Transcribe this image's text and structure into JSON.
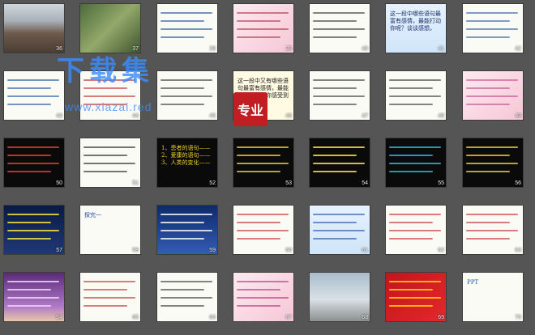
{
  "watermark": {
    "title": "下载集",
    "url": "www.xiazai.red",
    "seal": "专业"
  },
  "slides": [
    {
      "num": "36",
      "bg": "bg-mountain",
      "accent": "#6d5b4c"
    },
    {
      "num": "37",
      "bg": "bg-green",
      "accent": "#3f5530"
    },
    {
      "num": "38",
      "bg": "bg-white",
      "accent": "#1e4fa0"
    },
    {
      "num": "39",
      "bg": "bg-pink",
      "accent": "#b0324a"
    },
    {
      "num": "40",
      "bg": "bg-white",
      "accent": "#333333"
    },
    {
      "num": "41",
      "bg": "bg-lightblue",
      "accent": "#1a2b66",
      "text": "这一段中哪些语句最富有感情，最能打动你呢？谈谈感想。"
    },
    {
      "num": "42",
      "bg": "bg-white",
      "accent": "#2b5aa8"
    },
    {
      "num": "43",
      "bg": "bg-white",
      "accent": "#1e4fa0"
    },
    {
      "num": "44",
      "bg": "bg-white",
      "accent": "#c0282d"
    },
    {
      "num": "45",
      "bg": "bg-white",
      "accent": "#333333"
    },
    {
      "num": "46",
      "bg": "bg-yellow",
      "accent": "#1a1a1a",
      "text": "这一段中又有哪些语句最富有感情，最能打动你呢？你感受到了什么？"
    },
    {
      "num": "47",
      "bg": "bg-white",
      "accent": "#333333"
    },
    {
      "num": "48",
      "bg": "bg-white",
      "accent": "#333333"
    },
    {
      "num": "49",
      "bg": "bg-pink",
      "accent": "#c04a8a"
    },
    {
      "num": "50",
      "bg": "bg-black",
      "accent": "#e03a2a"
    },
    {
      "num": "51",
      "bg": "bg-white",
      "accent": "#1a1a1a"
    },
    {
      "num": "52",
      "bg": "bg-black",
      "accent": "#f0d020",
      "text": "1、患者的语句——  2、爱康的语句——  3、人类的变化——"
    },
    {
      "num": "53",
      "bg": "bg-black",
      "accent": "#e0c030"
    },
    {
      "num": "54",
      "bg": "bg-black",
      "accent": "#f0e040"
    },
    {
      "num": "55",
      "bg": "bg-black",
      "accent": "#2ab0d0"
    },
    {
      "num": "56",
      "bg": "bg-black",
      "accent": "#e0c030"
    },
    {
      "num": "57",
      "bg": "bg-navy",
      "accent": "#f0e040"
    },
    {
      "num": "58",
      "bg": "bg-white",
      "accent": "#1e4fa0",
      "text": "探究一"
    },
    {
      "num": "59",
      "bg": "bg-blue",
      "accent": "#f0f0f0"
    },
    {
      "num": "60",
      "bg": "bg-white",
      "accent": "#c0282d"
    },
    {
      "num": "61",
      "bg": "bg-lightblue",
      "accent": "#1e4fa0"
    },
    {
      "num": "62",
      "bg": "bg-white",
      "accent": "#c0282d"
    },
    {
      "num": "63",
      "bg": "bg-white",
      "accent": "#c0282d"
    },
    {
      "num": "64",
      "bg": "bg-purple",
      "accent": "#f0d0ff"
    },
    {
      "num": "65",
      "bg": "bg-white",
      "accent": "#c0282d"
    },
    {
      "num": "66",
      "bg": "bg-white",
      "accent": "#333333"
    },
    {
      "num": "67",
      "bg": "bg-pink",
      "accent": "#b03070"
    },
    {
      "num": "68",
      "bg": "bg-city",
      "accent": "#5a6a78"
    },
    {
      "num": "69",
      "bg": "bg-red",
      "accent": "#ffd200"
    },
    {
      "num": "70",
      "bg": "bg-white",
      "accent": "#1e4fa0",
      "text": "PPT"
    }
  ]
}
